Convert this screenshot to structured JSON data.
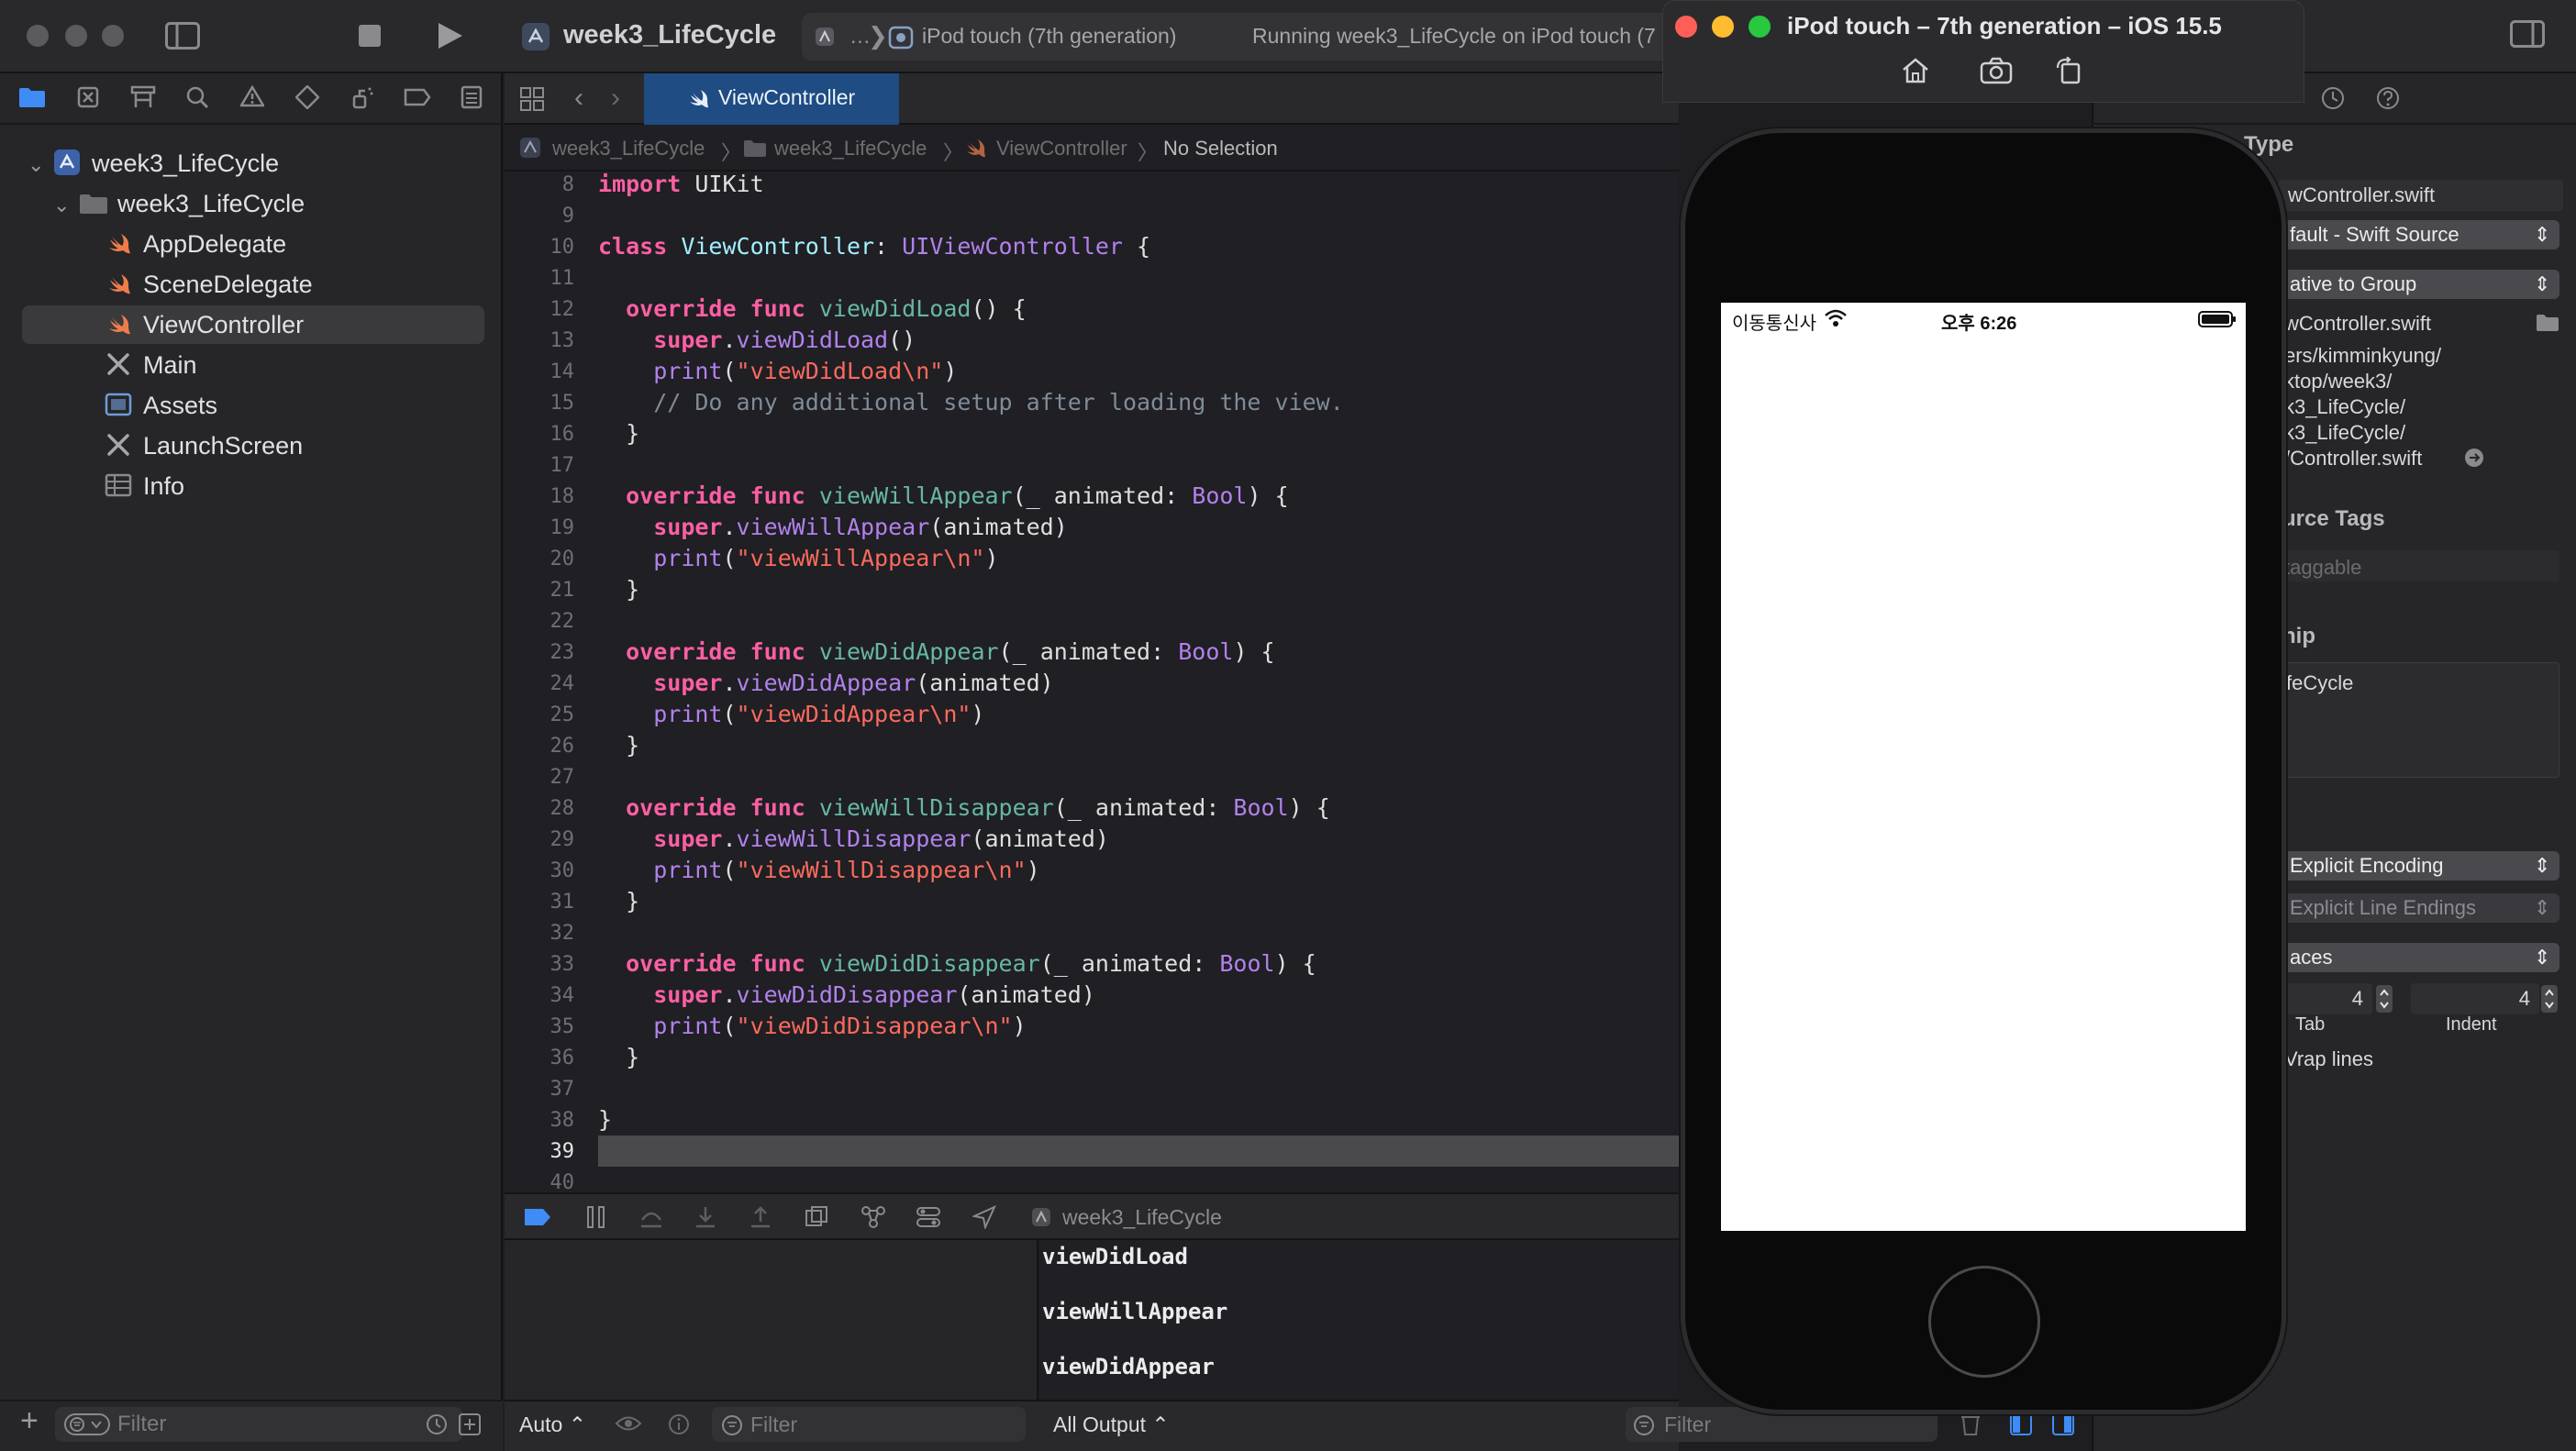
{
  "toolbar": {
    "project": "week3_LifeCycle",
    "scheme_overflow": "…",
    "device": "iPod touch (7th generation)",
    "status": "Running week3_LifeCycle on iPod touch (7"
  },
  "navigator": {
    "items": [
      {
        "label": "week3_LifeCycle"
      },
      {
        "label": "week3_LifeCycle"
      },
      {
        "label": "AppDelegate"
      },
      {
        "label": "SceneDelegate"
      },
      {
        "label": "ViewController"
      },
      {
        "label": "Main"
      },
      {
        "label": "Assets"
      },
      {
        "label": "LaunchScreen"
      },
      {
        "label": "Info"
      }
    ],
    "filter_placeholder": "Filter"
  },
  "editor": {
    "tab": "ViewController",
    "jumpbar": [
      "week3_LifeCycle",
      "week3_LifeCycle",
      "ViewController",
      "No Selection"
    ],
    "line_numbers": [
      "8",
      "9",
      "10",
      "11",
      "12",
      "13",
      "14",
      "15",
      "16",
      "17",
      "18",
      "19",
      "20",
      "21",
      "22",
      "23",
      "24",
      "25",
      "26",
      "27",
      "28",
      "29",
      "30",
      "31",
      "32",
      "33",
      "34",
      "35",
      "36",
      "37",
      "38",
      "39",
      "40"
    ]
  },
  "code": {
    "l8": [
      "import",
      " UIKit"
    ],
    "l10": [
      "class",
      " ",
      "ViewController",
      ": ",
      "UIViewController",
      " {"
    ],
    "l12": [
      "override",
      " ",
      "func",
      " ",
      "viewDidLoad",
      "() {"
    ],
    "l13": [
      "super",
      ".",
      "viewDidLoad",
      "()"
    ],
    "l14": [
      "print",
      "(",
      "\"viewDidLoad\\n\"",
      ")"
    ],
    "l15": "// Do any additional setup after loading the view.",
    "l16": "}",
    "l18": [
      "override",
      " ",
      "func",
      " ",
      "viewWillAppear",
      "(_ animated: ",
      "Bool",
      ") {"
    ],
    "l19": [
      "super",
      ".",
      "viewWillAppear",
      "(animated)"
    ],
    "l20": [
      "print",
      "(",
      "\"viewWillAppear\\n\"",
      ")"
    ],
    "l21": "}",
    "l23": [
      "override",
      " ",
      "func",
      " ",
      "viewDidAppear",
      "(_ animated: ",
      "Bool",
      ") {"
    ],
    "l24": [
      "super",
      ".",
      "viewDidAppear",
      "(animated)"
    ],
    "l25": [
      "print",
      "(",
      "\"viewDidAppear\\n\"",
      ")"
    ],
    "l26": "}",
    "l28": [
      "override",
      " ",
      "func",
      " ",
      "viewWillDisappear",
      "(_ animated: ",
      "Bool",
      ") {"
    ],
    "l29": [
      "super",
      ".",
      "viewWillDisappear",
      "(animated)"
    ],
    "l30": [
      "print",
      "(",
      "\"viewWillDisappear\\n\"",
      ")"
    ],
    "l31": "}",
    "l33": [
      "override",
      " ",
      "func",
      " ",
      "viewDidDisappear",
      "(_ animated: ",
      "Bool",
      ") {"
    ],
    "l34": [
      "super",
      ".",
      "viewDidDisappear",
      "(animated)"
    ],
    "l35": [
      "print",
      "(",
      "\"viewDidDisappear\\n\"",
      ")"
    ],
    "l36": "}",
    "l38": "}"
  },
  "debug": {
    "target": "week3_LifeCycle",
    "console": [
      "viewDidLoad",
      "viewWillAppear",
      "viewDidAppear"
    ],
    "auto": "Auto ⌃",
    "filter_placeholder": "Filter",
    "output": "All Output ⌃",
    "console_filter_placeholder": "Filter"
  },
  "inspector": {
    "type_heading": "Type",
    "name_value": "wController.swift",
    "file_type": "fault - Swift Source",
    "location": "ative to Group",
    "full_name": "wController.swift",
    "path_lines": [
      "ers/kimminkyung/",
      "ktop/week3/",
      "k3_LifeCycle/",
      "k3_LifeCycle/",
      "/Controller.swift"
    ],
    "resource_tags_heading": "urce Tags",
    "taggable": "taggable",
    "membership_heading": "hip",
    "target_membership": "feCycle",
    "encoding": "Explicit Encoding",
    "line_endings": "Explicit Line Endings",
    "indent_using": "aces",
    "tab_value": "4",
    "indent_value": "4",
    "tab_label": "Tab",
    "indent_label": "Indent",
    "wrap_lines": "Vrap lines"
  },
  "simulator": {
    "title": "iPod touch – 7th generation – iOS 15.5",
    "carrier": "이동통신사",
    "time": "오후 6:26"
  },
  "colors": {
    "keyword": "#fc5fa3",
    "type": "#a3eeff",
    "project_func": "#67b7a4",
    "system_func": "#b281eb",
    "string": "#fc6a5d",
    "comment": "#7f8c98",
    "active_tab": "#1e4c83"
  }
}
